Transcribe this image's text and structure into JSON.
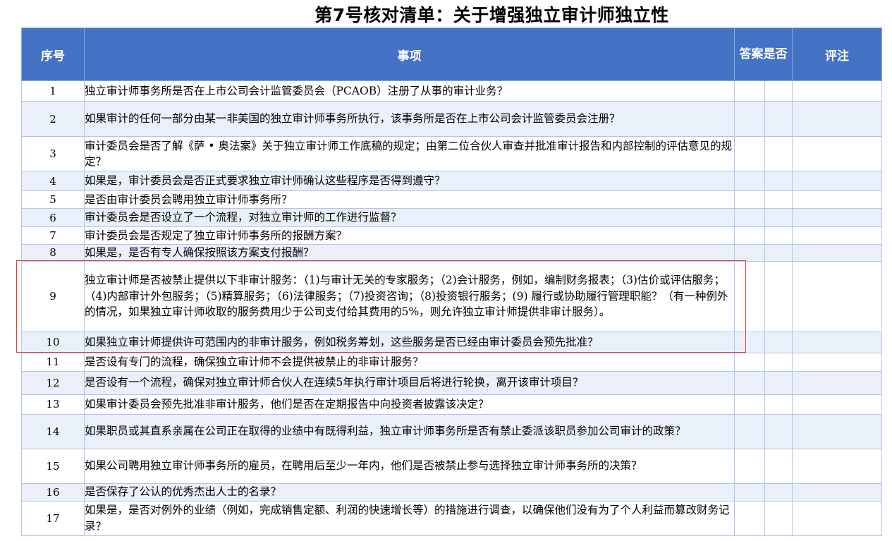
{
  "title": "第7号核对清单：关于增强独立审计师独立性",
  "headers": {
    "no": "序号",
    "item": "事项",
    "answer": "答案是否",
    "comment": "评注"
  },
  "rows": [
    {
      "no": "1",
      "text": "独立审计师事务所是否在上市公司会计监管委员会（PCAOB）注册了从事的审计业务？"
    },
    {
      "no": "2",
      "text": "如果审计的任何一部分由某一非美国的独立审计师事务所执行，该事务所是否在上市公司会计监管委员会注册？"
    },
    {
      "no": "3",
      "text": "审计委员会是否了解《萨 • 奥法案》关于独立审计师工作底稿的规定；由第二位合伙人审查并批准审计报告和内部控制的评估意见的规定？"
    },
    {
      "no": "4",
      "text": "如果是，审计委员会是否正式要求独立审计师确认这些程序是否得到遵守？"
    },
    {
      "no": "5",
      "text": "是否由审计委员会聘用独立审计师事务所？"
    },
    {
      "no": "6",
      "text": "审计委员会是否设立了一个流程，对独立审计师的工作进行监督？"
    },
    {
      "no": "7",
      "text": "审计委员会是否规定了独立审计师事务所的报酬方案？"
    },
    {
      "no": "8",
      "text": "如果是，是否有专人确保按照该方案支付报酬？"
    },
    {
      "no": "9",
      "text": "独立审计师是否被禁止提供以下非审计服务：（1)与审计无关的专家服务；（2)会计服务，例如，编制财务报表；（3)估价或评估服务；（4)内部审计外包服务；（5)精算服务；（6)法律服务；（7)投资咨询；（8)投资银行服务；(9) 履行或协助履行管理职能？（有一种例外的情况，如果独立审计师收取的服务费用少于公司支付给其费用的5%，则允许独立审计师提供非审计服务）。"
    },
    {
      "no": "10",
      "text": "如果独立审计师提供许可范围内的非审计服务，例如税务筹划，这些服务是否已经由审计委员会预先批准？"
    },
    {
      "no": "11",
      "text": "是否设有专门的流程，确保独立审计师不会提供被禁止的非审计服务？"
    },
    {
      "no": "12",
      "text": "是否设有一个流程，确保对独立审计师合伙人在连续5年执行审计项目后将进行轮换，离开该审计项目？"
    },
    {
      "no": "13",
      "text": "如果审计委员会预先批准非审计服务，他们是否在定期报告中向投资者披露该决定？"
    },
    {
      "no": "14",
      "text": "如果职员或其直系亲属在公司正在取得的业绩中有既得利益，独立审计师事务所是否有禁止委派该职员参加公司审计的政策？"
    },
    {
      "no": "15",
      "text": "如果公司聘用独立审计师事务所的雇员，在聘用后至少一年内，他们是否被禁止参与选择独立审计师事务所的决策？"
    },
    {
      "no": "16",
      "text": "是否保存了公认的优秀杰出人士的名录？"
    },
    {
      "no": "17",
      "text": "如果是，是否对例外的业绩（例如，完成销售定额、利润的快速增长等）的措施进行调查，以确保他们没有为了个人利益而篡改财务记录？"
    }
  ]
}
